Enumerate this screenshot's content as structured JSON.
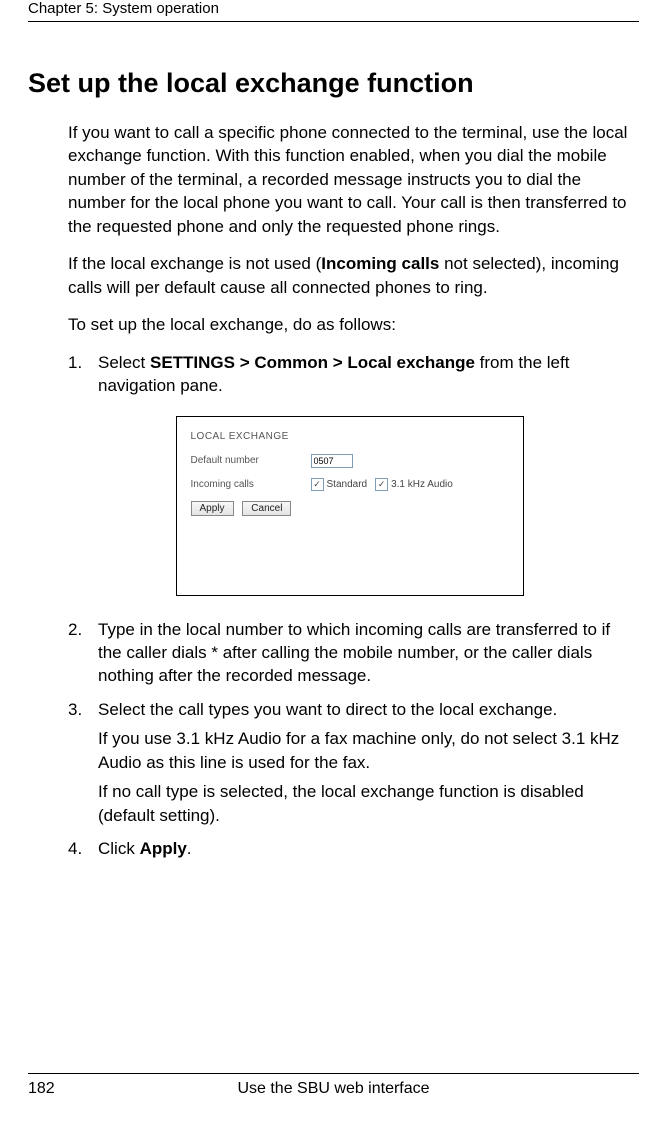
{
  "header": {
    "chapter": "Chapter 5:  System operation"
  },
  "h1": "Set up the local exchange function",
  "p1": "If you want to call a specific phone connected to the terminal, use the local exchange function. With this function enabled, when you dial the mobile number of the terminal, a recorded message instructs you to dial the number for the local phone you want to call. Your call is then transferred to the requested phone and only the requested phone rings.",
  "p2a": "If the local exchange is not used (",
  "p2b": "Incoming calls",
  "p2c": " not selected), incoming calls will per default cause all connected phones to ring.",
  "p3": "To set up the local exchange, do as follows:",
  "steps": {
    "s1_num": "1.",
    "s1a": "Select ",
    "s1b": "SETTINGS > Common > Local exchange",
    "s1c": " from the left navigation pane.",
    "s2_num": "2.",
    "s2": "Type in the local number to which incoming calls are transferred to if the caller dials * after calling the mobile number, or the caller dials nothing after the recorded message.",
    "s3_num": "3.",
    "s3a": "Select the call types you want to direct to the local exchange.",
    "s3b": "If you use 3.1 kHz Audio for a fax machine only, do not select 3.1 kHz Audio as this line is used for the fax.",
    "s3c": "If no call type is selected, the local exchange function is disabled (default setting).",
    "s4_num": "4.",
    "s4a": "Click ",
    "s4b": "Apply",
    "s4c": "."
  },
  "figure": {
    "title": "LOCAL EXCHANGE",
    "row1_label": "Default number",
    "row1_value": "0507",
    "row2_label": "Incoming calls",
    "cb1": "Standard",
    "cb2": "3.1 kHz Audio",
    "btn_apply": "Apply",
    "btn_cancel": "Cancel"
  },
  "footer": {
    "page": "182",
    "section": "Use the SBU web interface"
  }
}
